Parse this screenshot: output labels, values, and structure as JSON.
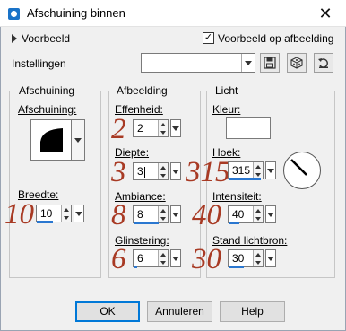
{
  "window": {
    "title": "Afschuining binnen",
    "close_glyph": "✕"
  },
  "top": {
    "preview_label": "Voorbeeld",
    "preview_on_image_label": "Voorbeeld op afbeelding",
    "preview_on_image_checked": true,
    "settings_label": "Instellingen",
    "settings_value": ""
  },
  "bevel": {
    "group_label": "Afschuining",
    "shape_label": "Afschuining:",
    "width_label": "Breedte:",
    "width_value": "10",
    "width_annotation": "10"
  },
  "image": {
    "group_label": "Afbeelding",
    "smoothness_label": "Effenheid:",
    "smoothness_value": "2",
    "smoothness_annotation": "2",
    "depth_label": "Diepte:",
    "depth_value": "3",
    "depth_annotation": "3",
    "ambience_label": "Ambiance:",
    "ambience_value": "8",
    "ambience_annotation": "8",
    "shininess_label": "Glinstering:",
    "shininess_value": "6",
    "shininess_annotation": "6"
  },
  "light": {
    "group_label": "Licht",
    "color_label": "Kleur:",
    "color_value": "#ffffff",
    "angle_label": "Hoek:",
    "angle_value": "315",
    "angle_annotation": "315",
    "intensity_label": "Intensiteit:",
    "intensity_value": "40",
    "intensity_annotation": "40",
    "elevation_label": "Stand lichtbron:",
    "elevation_value": "30",
    "elevation_annotation": "30"
  },
  "buttons": {
    "ok": "OK",
    "cancel": "Annuleren",
    "help": "Help"
  },
  "colors": {
    "annotation": "#a83a24",
    "accent": "#2a77d0"
  }
}
